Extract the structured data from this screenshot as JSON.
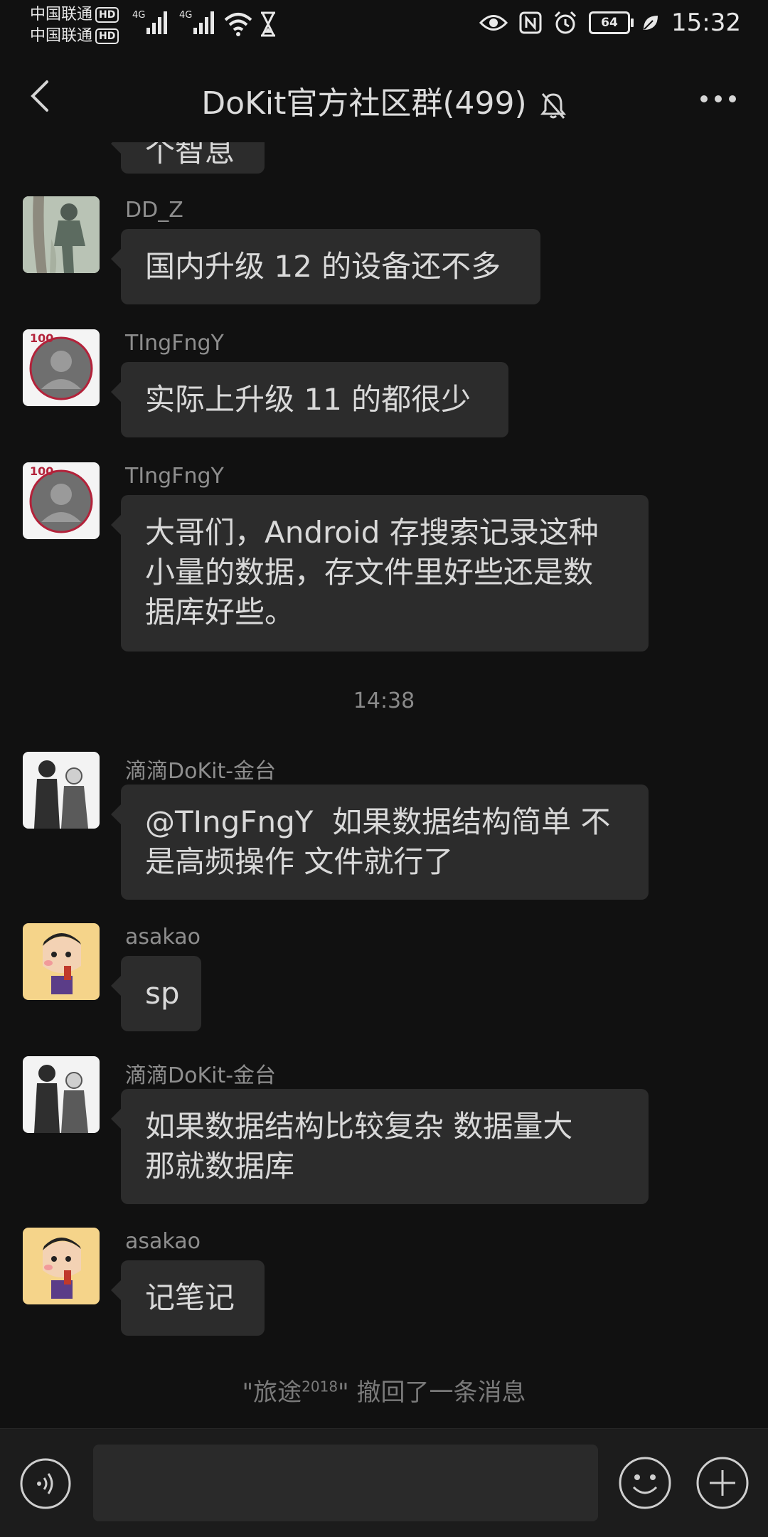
{
  "status_bar": {
    "carrier1": "中国联通",
    "carrier2": "中国联通",
    "hd_label": "HD",
    "net_type": "4G",
    "battery": "64",
    "time": "15:32"
  },
  "header": {
    "title": "DoKit官方社区群(499)"
  },
  "partial_top_bubble": "个智息",
  "messages": [
    {
      "sender": "DD_Z",
      "text": "国内升级 12 的设备还不多",
      "avatar": "anime-figure-avatar"
    },
    {
      "sender": "TIngFngY",
      "text": "实际上升级 11 的都很少",
      "avatar": "default-person-avatar"
    },
    {
      "sender": "TIngFngY",
      "text": "大哥们，Android 存搜索记录这种\n小量的数据，存文件里好些还是数\n据库好些。",
      "avatar": "default-person-avatar"
    },
    {
      "sender": "滴滴DoKit-金台",
      "text": "@TIngFngY  如果数据结构简单 不\n是高频操作 文件就行了",
      "avatar": "duo-sketch-avatar"
    },
    {
      "sender": "asakao",
      "text": "sp",
      "avatar": "cartoon-boy-avatar"
    },
    {
      "sender": "滴滴DoKit-金台",
      "text": "如果数据结构比较复杂 数据量大\n那就数据库",
      "avatar": "duo-sketch-avatar"
    },
    {
      "sender": "asakao",
      "text": "记笔记",
      "avatar": "cartoon-boy-avatar"
    }
  ],
  "timestamp": "14:38",
  "system_note": {
    "prefix": "\"旅途",
    "sup": "2018",
    "suffix": "\" 撤回了一条消息"
  },
  "colors": {
    "background": "#111111",
    "bubble": "#2c2c2c",
    "text": "#d9d9d9",
    "muted": "#8e8e8e"
  }
}
